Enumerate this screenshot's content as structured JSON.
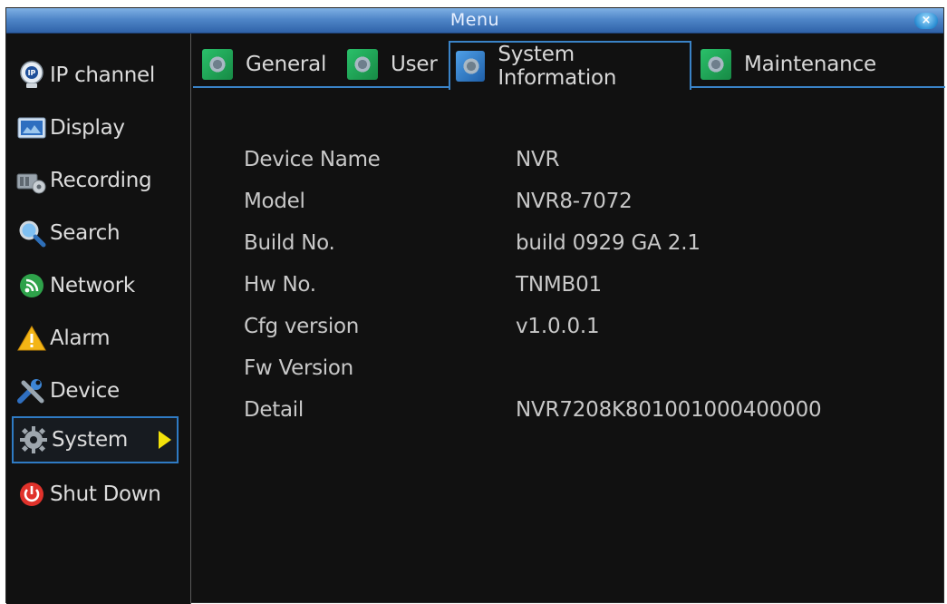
{
  "window": {
    "title": "Menu",
    "close_label": "×"
  },
  "sidebar": {
    "items": [
      {
        "label": "IP channel",
        "icon": "ip-camera-icon"
      },
      {
        "label": "Display",
        "icon": "display-icon"
      },
      {
        "label": "Recording",
        "icon": "recording-icon"
      },
      {
        "label": "Search",
        "icon": "search-icon"
      },
      {
        "label": "Network",
        "icon": "network-icon"
      },
      {
        "label": "Alarm",
        "icon": "alarm-icon"
      },
      {
        "label": "Device",
        "icon": "device-tools-icon"
      },
      {
        "label": "System",
        "icon": "system-gear-icon",
        "active": true
      },
      {
        "label": "Shut Down",
        "icon": "power-icon"
      }
    ]
  },
  "tabs": [
    {
      "label": "General"
    },
    {
      "label": "User"
    },
    {
      "label": "System Information",
      "active": true
    },
    {
      "label": "Maintenance"
    }
  ],
  "system_info": {
    "rows": [
      {
        "key": "Device Name",
        "value": "NVR"
      },
      {
        "key": "Model",
        "value": "NVR8-7072"
      },
      {
        "key": "Build No.",
        "value": "build 0929 GA 2.1"
      },
      {
        "key": "Hw No.",
        "value": "TNMB01"
      },
      {
        "key": "Cfg version",
        "value": "v1.0.0.1"
      },
      {
        "key": "Fw Version",
        "value": ""
      },
      {
        "key": "Detail",
        "value": "NVR7208K801001000400000"
      }
    ]
  },
  "colors": {
    "accent": "#3a83c7",
    "arrow": "#f3e20a",
    "background": "#111111"
  }
}
